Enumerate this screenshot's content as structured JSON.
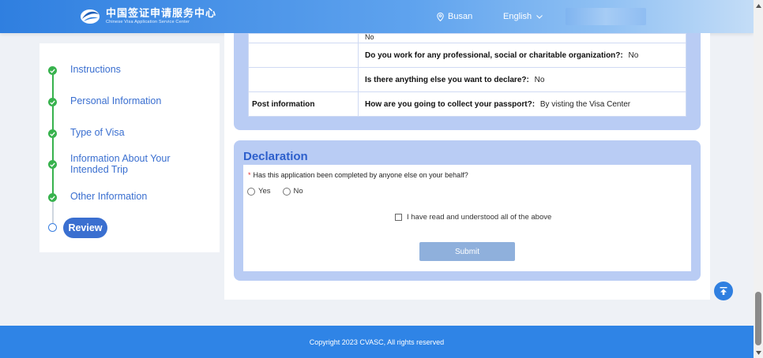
{
  "header": {
    "logo_cn": "中国签证申请服务中心",
    "logo_en": "Chinese Visa Application Service Center",
    "location": "Busan",
    "language": "English"
  },
  "sidebar": {
    "steps": [
      {
        "label": "Instructions",
        "status": "done"
      },
      {
        "label": "Personal Information",
        "status": "done"
      },
      {
        "label": "Type of Visa",
        "status": "done"
      },
      {
        "label_line1": "Information About Your",
        "label_line2": "Intended Trip",
        "status": "done"
      },
      {
        "label": "Other Information",
        "status": "done"
      },
      {
        "label": "Review",
        "status": "current"
      }
    ]
  },
  "summary_table": {
    "rows": [
      {
        "section": "",
        "question": "",
        "answer": "No"
      },
      {
        "section": "",
        "question": "Do you work for any professional, social or charitable organization?:",
        "answer": "No"
      },
      {
        "section": "",
        "question": "Is there anything else you want to declare?:",
        "answer": "No"
      },
      {
        "section": "Post information",
        "question": "How are you going to collect your passport?:",
        "answer": "By visting the Visa Center"
      }
    ]
  },
  "declaration": {
    "title": "Declaration",
    "required_mark": "*",
    "question": "Has this application been completed by anyone else on your behalf?",
    "options": [
      "Yes",
      "No"
    ],
    "agree_label": "I have read and understood all of the above",
    "submit_label": "Submit"
  },
  "footer": {
    "copyright": "Copyright 2023 CVASC, All rights reserved"
  },
  "colors": {
    "brand_blue": "#2f7fe0",
    "step_green": "#37b24d",
    "frame_blue": "#b9ccf4",
    "title_blue": "#2d5fcc"
  }
}
